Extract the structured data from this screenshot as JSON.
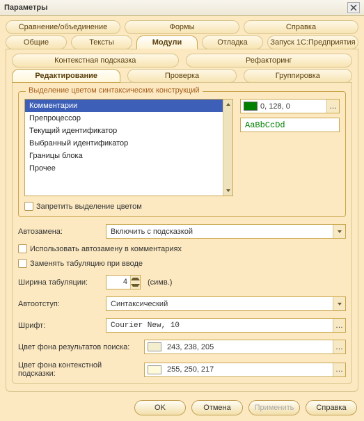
{
  "window": {
    "title": "Параметры"
  },
  "tabs_row1": [
    "Сравнение/объединение",
    "Формы",
    "Справка"
  ],
  "tabs_row2": [
    "Общие",
    "Тексты",
    "Модули",
    "Отладка",
    "Запуск 1С:Предприятия"
  ],
  "active_tab": "Модули",
  "subtabs_row1": [
    "Контекстная подсказка",
    "Рефакторинг"
  ],
  "subtabs_row2": [
    "Редактирование",
    "Проверка",
    "Группировка"
  ],
  "active_subtab": "Редактирование",
  "syntax": {
    "legend": "Выделение цветом синтаксических конструкций",
    "items": [
      "Комментарии",
      "Препроцессор",
      "Текущий идентификатор",
      "Выбранный идентификатор",
      "Границы блока",
      "Прочее"
    ],
    "selected_index": 0,
    "color_value": "0, 128, 0",
    "color_swatch": "#008000",
    "preview_text": "AaBbCcDd",
    "preview_color": "#008000"
  },
  "checkboxes": {
    "disable_highlight": "Запретить выделение цветом",
    "autocomplete_in_comments": "Использовать автозамену в комментариях",
    "replace_tabs": "Заменять табуляцию при вводе"
  },
  "autoreplace": {
    "label": "Автозамена:",
    "value": "Включить с подсказкой"
  },
  "tab_width": {
    "label": "Ширина табуляции:",
    "value": "4",
    "unit": "(симв.)"
  },
  "autoindent": {
    "label": "Автоотступ:",
    "value": "Синтаксический"
  },
  "font": {
    "label": "Шрифт:",
    "value": "Courier New, 10"
  },
  "search_bg": {
    "label": "Цвет фона результатов поиска:",
    "value": "243, 238, 205",
    "swatch": "#f3eecd"
  },
  "hint_bg": {
    "label": "Цвет фона контекстной подсказки:",
    "value": "255, 250, 217",
    "swatch": "#fffad9"
  },
  "buttons": {
    "ok": "OK",
    "cancel": "Отмена",
    "apply": "Применить",
    "help": "Справка"
  }
}
